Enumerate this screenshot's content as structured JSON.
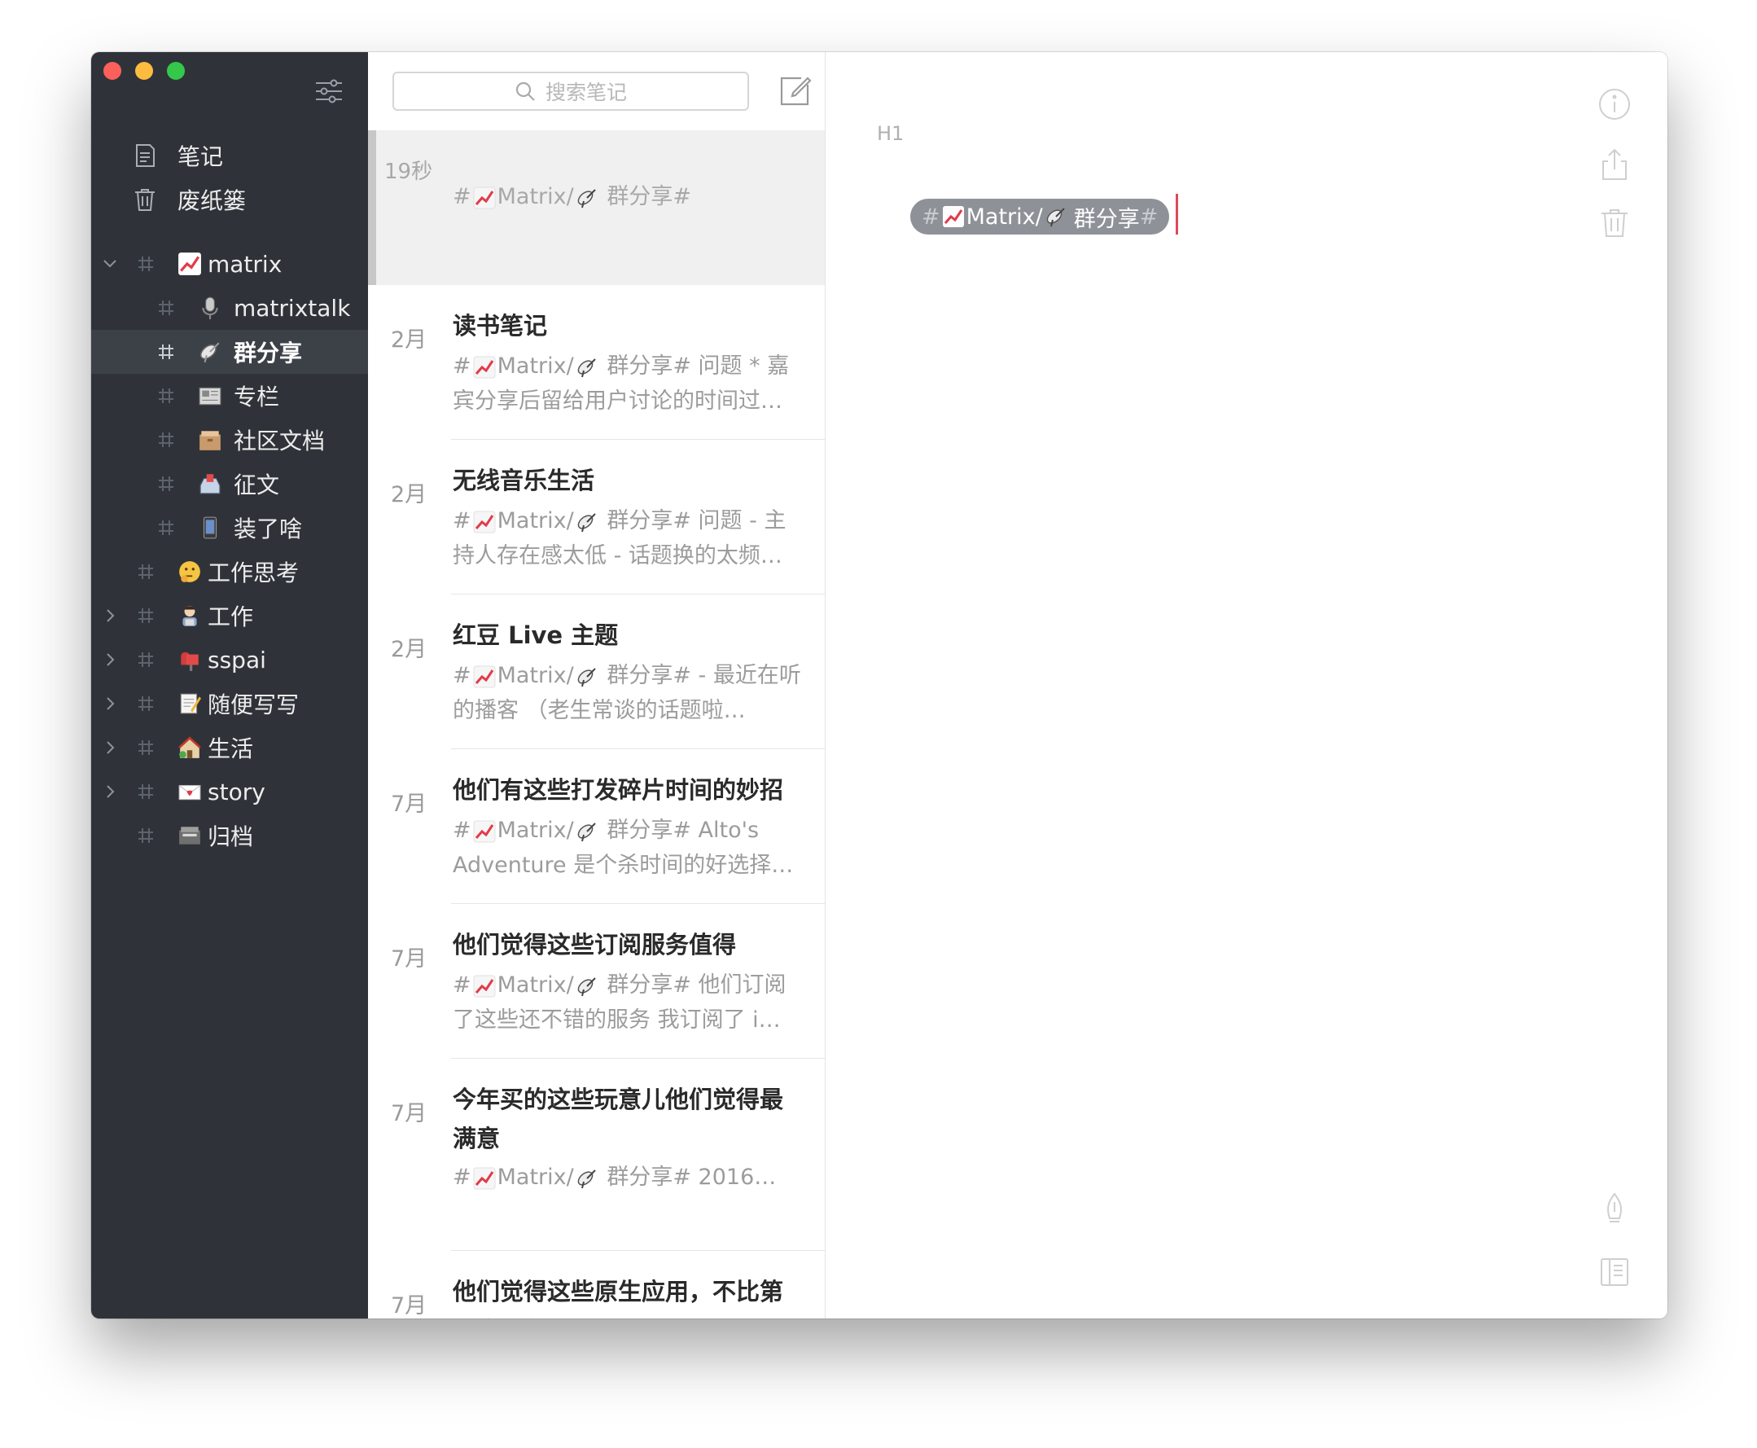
{
  "sidebar": {
    "nav": [
      {
        "label": "笔记",
        "icon": "note-icon"
      },
      {
        "label": "废纸篓",
        "icon": "trash-icon"
      }
    ],
    "tags": [
      {
        "label": "matrix",
        "emoji": "chart-emoji",
        "level": 0,
        "chevron": "down"
      },
      {
        "label": "matrixtalk",
        "emoji": "microphone-emoji",
        "level": 1,
        "chevron": ""
      },
      {
        "label": "群分享",
        "emoji": "satellite-dish-emoji",
        "level": 1,
        "chevron": "",
        "selected": true
      },
      {
        "label": "专栏",
        "emoji": "newspaper-emoji",
        "level": 1,
        "chevron": ""
      },
      {
        "label": "社区文档",
        "emoji": "file-box-emoji",
        "level": 1,
        "chevron": ""
      },
      {
        "label": "征文",
        "emoji": "inbox-tray-emoji",
        "level": 1,
        "chevron": ""
      },
      {
        "label": "装了啥",
        "emoji": "mobile-phone-emoji",
        "level": 1,
        "chevron": ""
      },
      {
        "label": "工作思考",
        "emoji": "thinking-face-emoji",
        "level": 0,
        "chevron": ""
      },
      {
        "label": "工作",
        "emoji": "office-worker-emoji",
        "level": 0,
        "chevron": "right"
      },
      {
        "label": "sspai",
        "emoji": "mailbox-emoji",
        "level": 0,
        "chevron": "right"
      },
      {
        "label": "随便写写",
        "emoji": "memo-emoji",
        "level": 0,
        "chevron": "right"
      },
      {
        "label": "生活",
        "emoji": "house-emoji",
        "level": 0,
        "chevron": "right"
      },
      {
        "label": "story",
        "emoji": "love-letter-emoji",
        "level": 0,
        "chevron": "right"
      },
      {
        "label": "归档",
        "emoji": "card-box-emoji",
        "level": 0,
        "chevron": ""
      }
    ]
  },
  "list": {
    "search_placeholder": "搜索笔记",
    "tag_prefix": "#",
    "tag_matrix": "Matrix/",
    "tag_group": "群分享#",
    "notes": [
      {
        "date": "19秒",
        "title": "",
        "preview_rest": "",
        "active": true
      },
      {
        "date": "2月",
        "title": "读书笔记",
        "preview_rest": " 问题 * 嘉宾分享后留给用户讨论的时间过…"
      },
      {
        "date": "2月",
        "title": "无线音乐生活",
        "preview_rest": " 问题 - 主持人存在感太低 - 话题换的太频…"
      },
      {
        "date": "2月",
        "title": "红豆 Live 主题",
        "preview_rest": " - 最近在听的播客 （老生常谈的话题啦…"
      },
      {
        "date": "7月",
        "title": "他们有这些打发碎片时间的妙招",
        "preview_rest": " Alto's Adventure 是个杀时间的好选择…"
      },
      {
        "date": "7月",
        "title": "他们觉得这些订阅服务值得",
        "preview_rest": " 他们订阅了这些还不错的服务 我订阅了 i…"
      },
      {
        "date": "7月",
        "title": "今年买的这些玩意儿他们觉得最满意",
        "preview_rest": " 2016…",
        "tall": true
      },
      {
        "date": "7月",
        "title": "他们觉得这些原生应用，不比第三方逊色 | Matrix Early Birds…",
        "preview_rest": "",
        "tall": true
      }
    ]
  },
  "editor": {
    "heading_marker": "H1",
    "chip_prefix": "#",
    "chip_matrix": "Matrix/",
    "chip_group": "群分享",
    "chip_suffix": "#",
    "icons": [
      "info-icon",
      "share-icon",
      "trash-icon",
      "pen-icon",
      "notes-icon"
    ]
  },
  "colors": {
    "sidebar_bg": "#2f3339",
    "sidebar_selected": "#3c4047",
    "chip_bg": "#8e9298",
    "caret": "#e0475a"
  }
}
